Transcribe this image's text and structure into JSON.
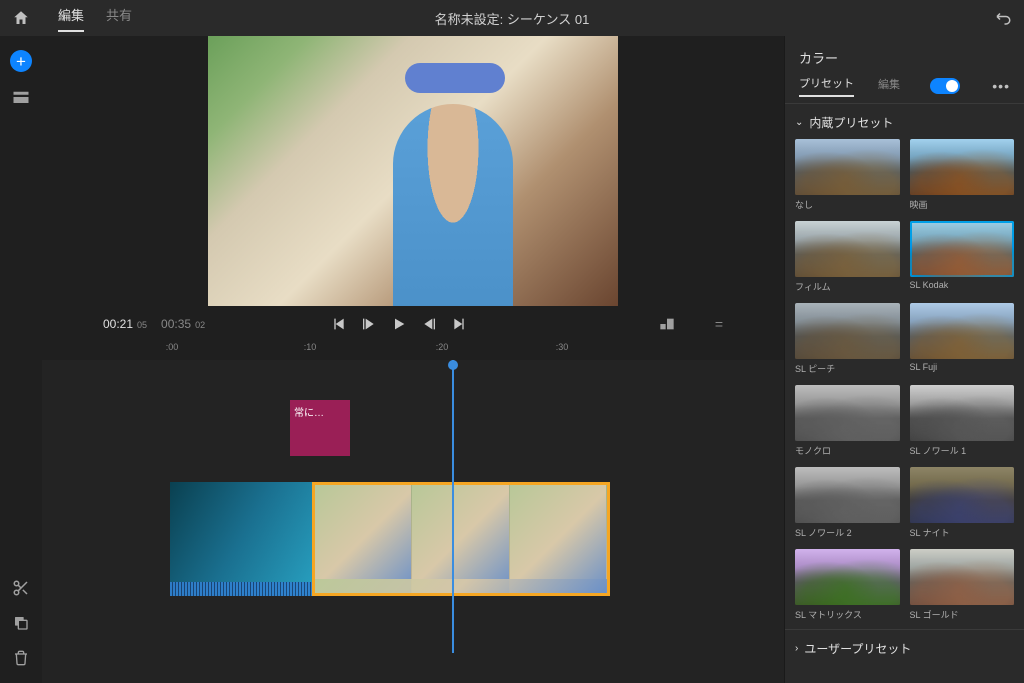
{
  "header": {
    "tabs": {
      "edit": "編集",
      "share": "共有"
    },
    "title": "名称未設定: シーケンス 01"
  },
  "transport": {
    "current": "00:21",
    "current_frames": "05",
    "duration": "00:35",
    "duration_frames": "02"
  },
  "ruler": {
    "t0": ":00",
    "t10": ":10",
    "t20": ":20",
    "t30": ":30"
  },
  "timeline": {
    "title_clip": "常に…"
  },
  "panel": {
    "title": "カラー",
    "tabs": {
      "preset": "プリセット",
      "edit": "編集"
    },
    "builtin_header": "内蔵プリセット",
    "user_header": "ユーザープリセット",
    "presets": {
      "none": "なし",
      "cinema": "映画",
      "film": "フィルム",
      "kodak": "SL Kodak",
      "peach": "SL ピーチ",
      "fuji": "SL Fuji",
      "mono": "モノクロ",
      "noir1": "SL ノワール 1",
      "noir2": "SL ノワール 2",
      "night": "SL ナイト",
      "matrix": "SL マトリックス",
      "gold": "SL ゴールド"
    }
  }
}
